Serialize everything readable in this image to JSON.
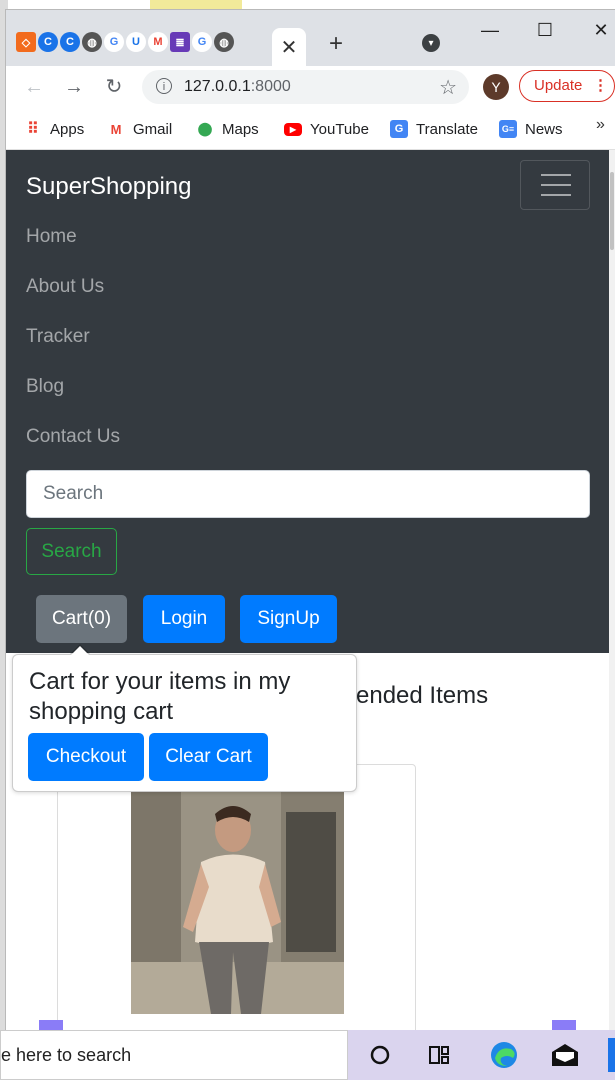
{
  "browser": {
    "tab_close": "✕",
    "new_tab": "+",
    "url_host": "127.0.0.1",
    "url_port": ":8000",
    "profile_initial": "Y",
    "update_label": "Update",
    "bookmarks": [
      {
        "label": "Apps",
        "icon": "apps-grid-icon"
      },
      {
        "label": "Gmail",
        "icon": "gmail-icon"
      },
      {
        "label": "Maps",
        "icon": "maps-icon"
      },
      {
        "label": "YouTube",
        "icon": "youtube-icon"
      },
      {
        "label": "Translate",
        "icon": "translate-icon"
      },
      {
        "label": "News",
        "icon": "news-icon"
      }
    ],
    "more": "»"
  },
  "navbar": {
    "brand": "SuperShopping",
    "links": [
      "Home",
      "About Us",
      "Tracker",
      "Blog",
      "Contact Us"
    ],
    "search_placeholder": "Search",
    "search_button": "Search",
    "cart_button": "Cart(0)",
    "login_button": "Login",
    "signup_button": "SignUp"
  },
  "popover": {
    "title": "Cart for your items in my shopping cart",
    "checkout": "Checkout",
    "clear": "Clear Cart"
  },
  "main": {
    "rec_title_visible": "mended Items"
  },
  "taskbar": {
    "search_text": "e here to search"
  },
  "colors": {
    "navbar_bg": "#343a40",
    "primary": "#007bff",
    "secondary": "#6c757d",
    "success": "#28a745"
  }
}
